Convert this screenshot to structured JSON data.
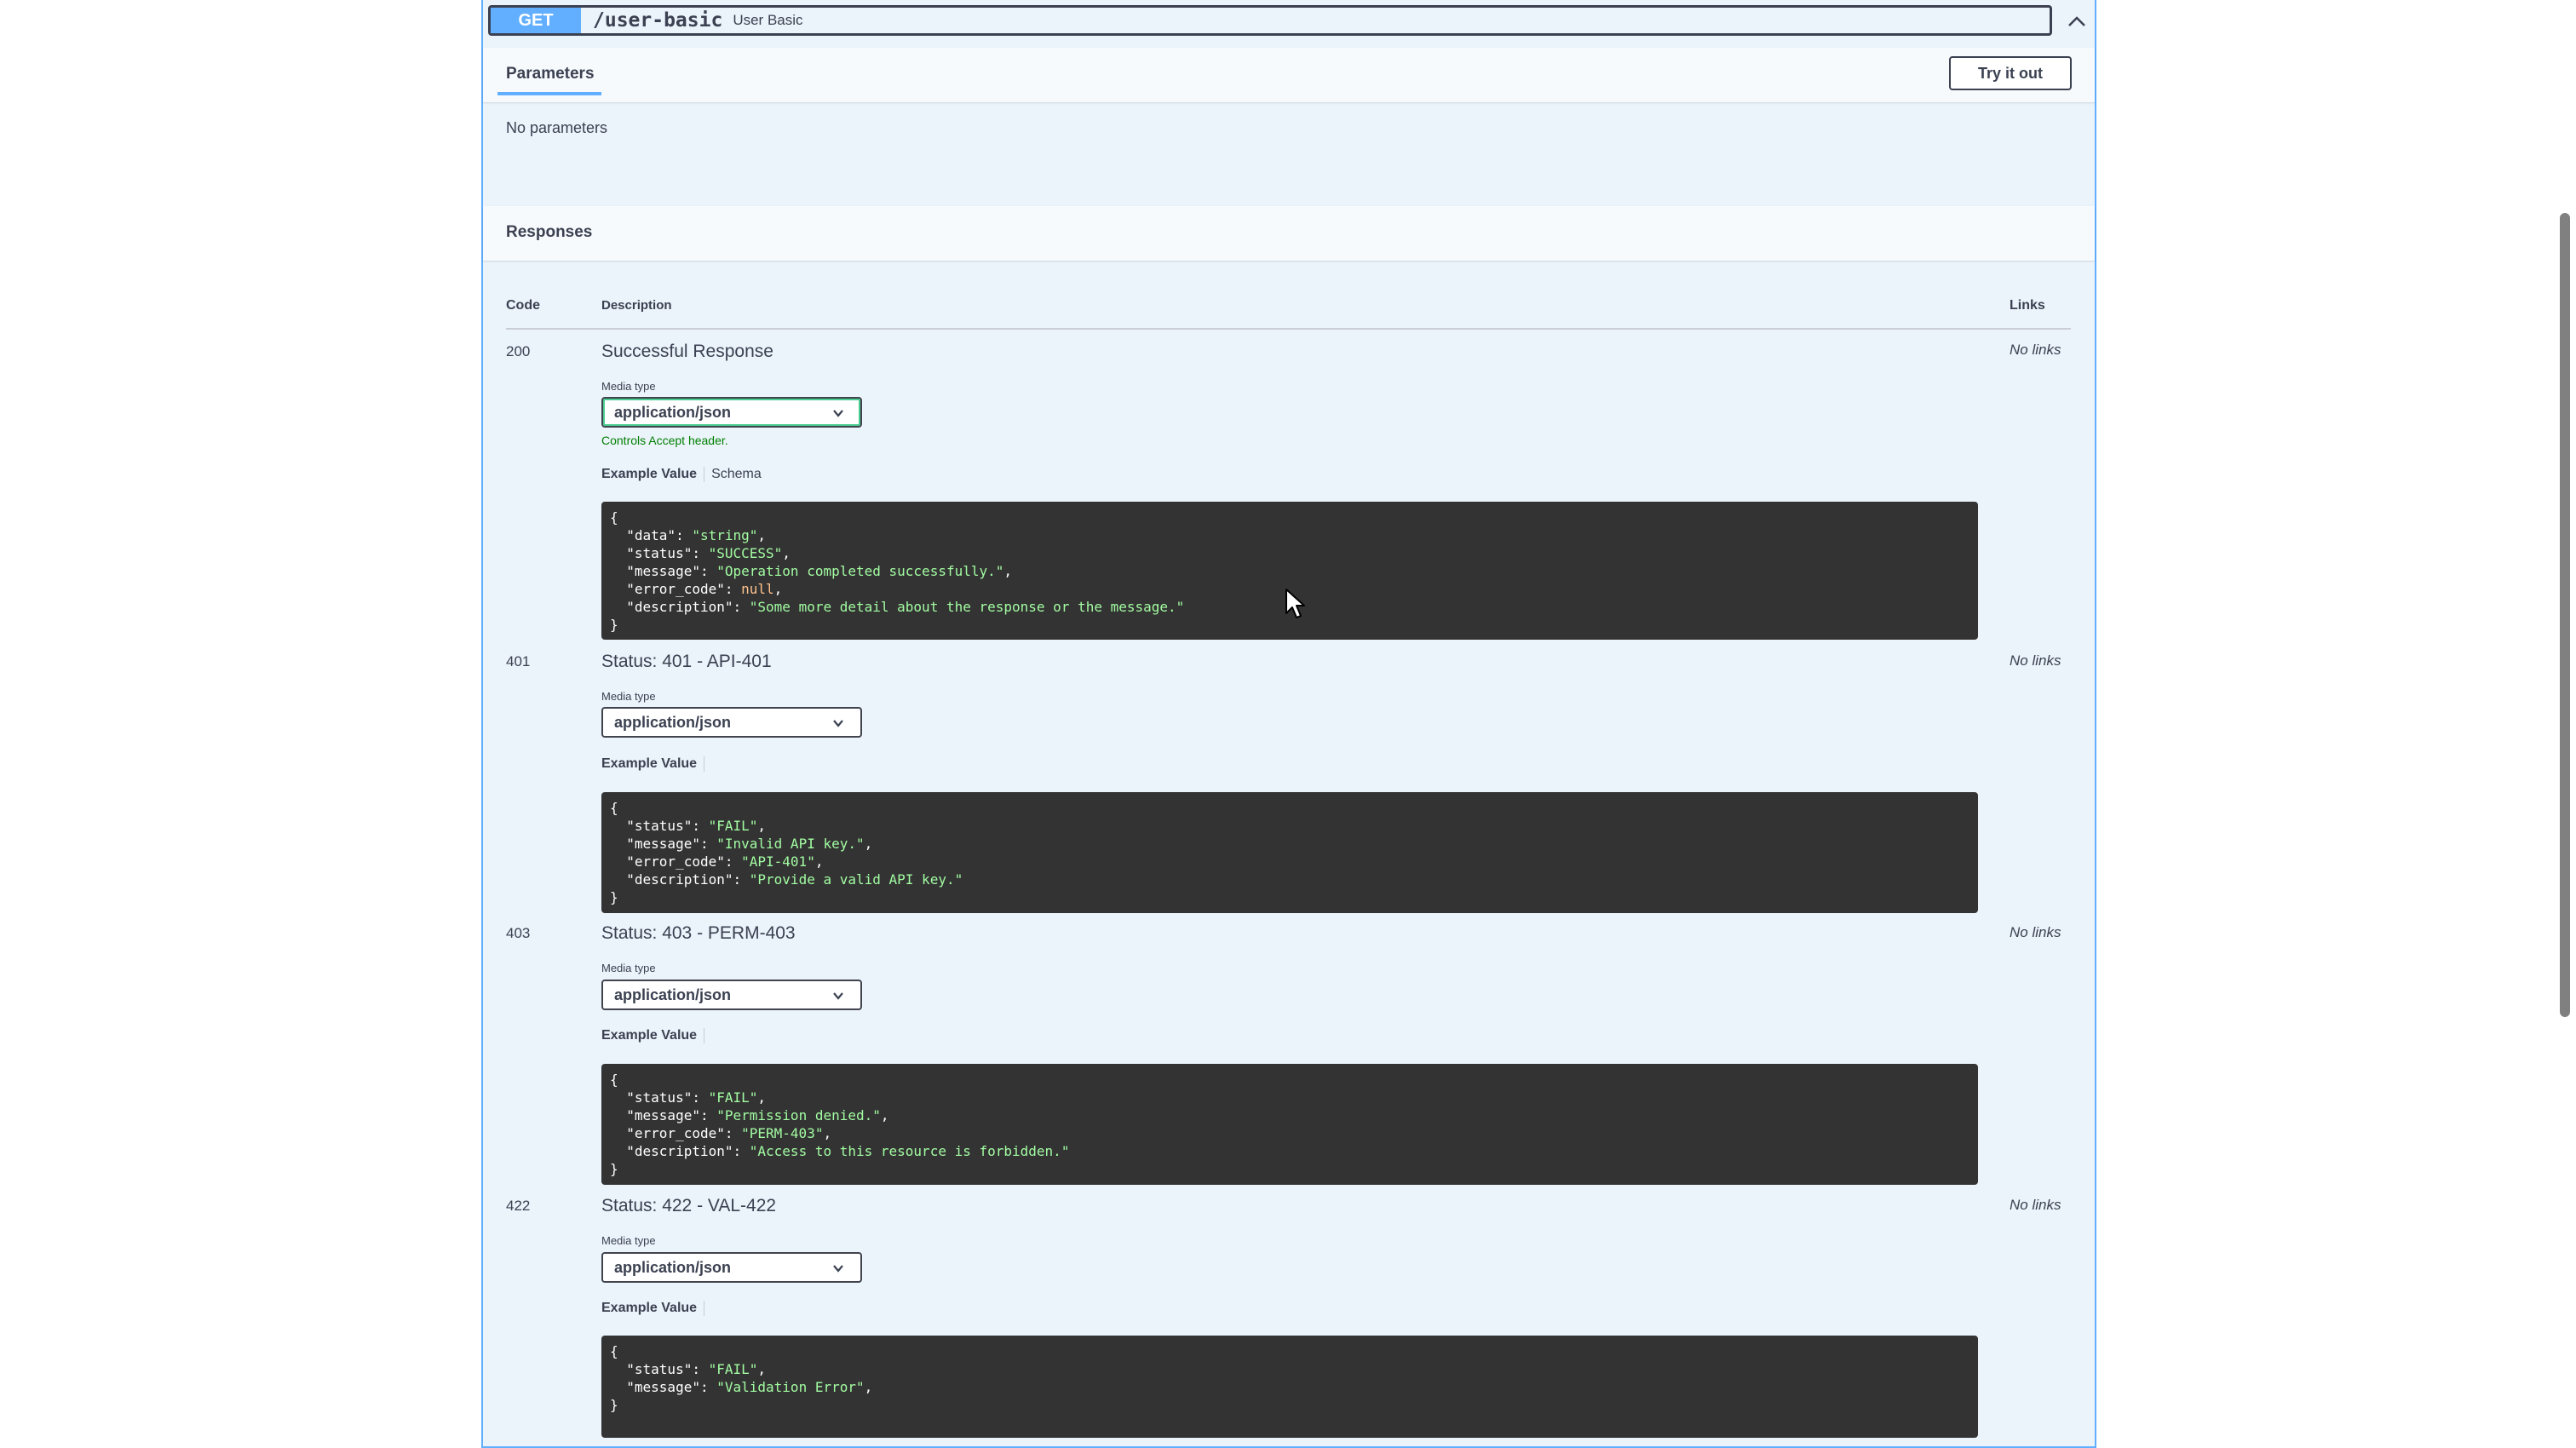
{
  "summary": {
    "method": "GET",
    "path": "/user-basic",
    "description": "User Basic"
  },
  "tabs": {
    "parameters": "Parameters",
    "try_it_out": "Try it out"
  },
  "parameters": {
    "empty": "No parameters"
  },
  "responses": {
    "title": "Responses",
    "headers": {
      "code": "Code",
      "description": "Description",
      "links": "Links"
    },
    "items": [
      {
        "code": "200",
        "description": "Successful Response",
        "media_type_label": "Media type",
        "media_type": "application/json",
        "accept_note": "Controls Accept header.",
        "example_tab": "Example Value",
        "schema_tab": "Schema",
        "links": "No links",
        "example": [
          {
            "k": "\"data\"",
            "v": "\"string\"",
            "type": "s",
            "comma": true
          },
          {
            "k": "\"status\"",
            "v": "\"SUCCESS\"",
            "type": "s",
            "comma": true
          },
          {
            "k": "\"message\"",
            "v": "\"Operation completed successfully.\"",
            "type": "s",
            "comma": true
          },
          {
            "k": "\"error_code\"",
            "v": "null",
            "type": "n",
            "comma": true
          },
          {
            "k": "\"description\"",
            "v": "\"Some more detail about the response or the message.\"",
            "type": "s",
            "comma": false
          }
        ]
      },
      {
        "code": "401",
        "description": "Status: 401 - API-401",
        "media_type_label": "Media type",
        "media_type": "application/json",
        "example_tab": "Example Value",
        "links": "No links",
        "example": [
          {
            "k": "\"status\"",
            "v": "\"FAIL\"",
            "type": "s",
            "comma": true
          },
          {
            "k": "\"message\"",
            "v": "\"Invalid API key.\"",
            "type": "s",
            "comma": true
          },
          {
            "k": "\"error_code\"",
            "v": "\"API-401\"",
            "type": "s",
            "comma": true
          },
          {
            "k": "\"description\"",
            "v": "\"Provide a valid API key.\"",
            "type": "s",
            "comma": false
          }
        ]
      },
      {
        "code": "403",
        "description": "Status: 403 - PERM-403",
        "media_type_label": "Media type",
        "media_type": "application/json",
        "example_tab": "Example Value",
        "links": "No links",
        "example": [
          {
            "k": "\"status\"",
            "v": "\"FAIL\"",
            "type": "s",
            "comma": true
          },
          {
            "k": "\"message\"",
            "v": "\"Permission denied.\"",
            "type": "s",
            "comma": true
          },
          {
            "k": "\"error_code\"",
            "v": "\"PERM-403\"",
            "type": "s",
            "comma": true
          },
          {
            "k": "\"description\"",
            "v": "\"Access to this resource is forbidden.\"",
            "type": "s",
            "comma": false
          }
        ]
      },
      {
        "code": "422",
        "description": "Status: 422 - VAL-422",
        "media_type_label": "Media type",
        "media_type": "application/json",
        "example_tab": "Example Value",
        "links": "No links",
        "example": [
          {
            "k": "\"status\"",
            "v": "\"FAIL\"",
            "type": "s",
            "comma": true
          },
          {
            "k": "\"message\"",
            "v": "\"Validation Error\"",
            "type": "s",
            "comma": true
          }
        ]
      }
    ]
  },
  "colors": {
    "get": "#61affe",
    "code_bg": "#333333",
    "string": "#a2fca2",
    "null": "#fcc28c",
    "accept_note": "#008000"
  }
}
